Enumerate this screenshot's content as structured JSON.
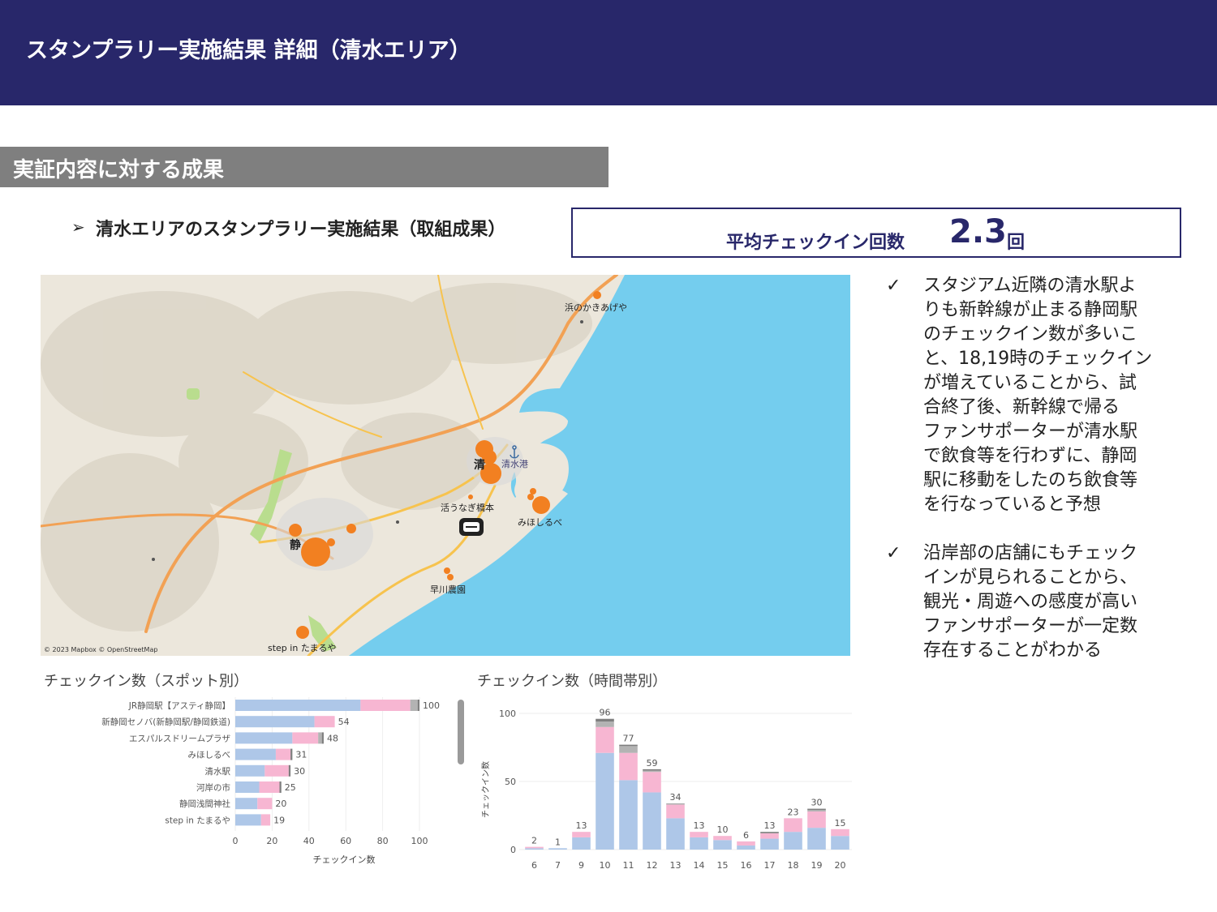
{
  "header": {
    "title": "スタンプラリー実施結果 詳細（清水エリア）"
  },
  "section": {
    "title": "実証内容に対する成果"
  },
  "subheading": {
    "marker": "➢",
    "text": "清水エリアのスタンプラリー実施結果（取組成果）"
  },
  "summary": {
    "label": "平均チェックイン回数",
    "value": "2.3",
    "unit": "回"
  },
  "map": {
    "attribution": "© 2023 Mapbox © OpenStreetMap",
    "labels": {
      "hama": "浜のかきあげや",
      "shimizu_port": "清水港",
      "katsu": "活うなぎ橋本",
      "mihoshirube": "みほしるべ",
      "hayakawa": "早川農園",
      "stepin": "step in たまるや",
      "shimizu_char": "清",
      "shizuoka_char": "静"
    },
    "colors": {
      "land": "#ece7dc",
      "sea": "#74cdee",
      "marker": "#f28021",
      "road": "#f7c34e",
      "highway": "#f2a154",
      "green": "#b9dd8e"
    }
  },
  "notes": [
    {
      "check": "✓",
      "lines": [
        "スタジアム近隣の清水駅よ",
        "りも新幹線が止まる静岡駅",
        "のチェックイン数が多いこ",
        "と、18,19時のチェックイン",
        "が増えていることから、試",
        "合終了後、新幹線で帰る",
        "ファンサポーターが清水駅",
        "で飲食等を行わずに、静岡",
        "駅に移動をしたのち飲食等",
        "を行なっていると予想"
      ]
    },
    {
      "check": "✓",
      "lines": [
        "沿岸部の店舗にもチェック",
        "インが見られることから、",
        "観光・周遊への感度が高い",
        "ファンサポーターが一定数",
        "存在することがわかる"
      ]
    }
  ],
  "chart_data": [
    {
      "type": "bar",
      "orientation": "horizontal",
      "stacked": true,
      "title": "チェックイン数（スポット別）",
      "xlabel": "チェックイン数",
      "ylabel": "",
      "xlim": [
        0,
        110
      ],
      "xticks": [
        0,
        20,
        40,
        60,
        80,
        100
      ],
      "categories": [
        "JR静岡駅【アスティ静岡】",
        "新静岡セノバ(新静岡駅/静岡鉄道)",
        "エスパルスドリームプラザ",
        "みほしるべ",
        "清水駅",
        "河岸の市",
        "静岡浅間神社",
        "step in たまるや"
      ],
      "series": [
        {
          "color": "#aec7e8",
          "values": [
            68,
            43,
            31,
            22,
            16,
            13,
            12,
            14
          ]
        },
        {
          "color": "#f7b6d2",
          "values": [
            27,
            11,
            14,
            8,
            13,
            11,
            8,
            5
          ]
        },
        {
          "color": "#b3b3b3",
          "values": [
            4,
            0,
            2,
            0,
            0,
            0,
            0,
            0
          ]
        },
        {
          "color": "#7f7f7f",
          "values": [
            1,
            0,
            1,
            1,
            1,
            1,
            0,
            0
          ]
        }
      ],
      "totals": [
        100,
        54,
        48,
        31,
        30,
        25,
        20,
        19
      ],
      "colors": {
        "blue": "#aec7e8",
        "pink": "#f7b6d2",
        "grey": "#b3b3b3",
        "dark": "#7f7f7f"
      }
    },
    {
      "type": "bar",
      "stacked": true,
      "title": "チェックイン数（時間帯別）",
      "xlabel": "",
      "ylabel": "チェックイン数",
      "ylim": [
        0,
        100
      ],
      "yticks": [
        0,
        50,
        100
      ],
      "categories": [
        "6",
        "7",
        "9",
        "10",
        "11",
        "12",
        "13",
        "14",
        "15",
        "16",
        "17",
        "18",
        "19",
        "20"
      ],
      "series": [
        {
          "color": "#aec7e8",
          "values": [
            1,
            1,
            9,
            71,
            51,
            42,
            23,
            9,
            7,
            3,
            8,
            13,
            16,
            10
          ]
        },
        {
          "color": "#f7b6d2",
          "values": [
            1,
            0,
            4,
            19,
            20,
            15,
            10,
            4,
            3,
            3,
            4,
            10,
            12,
            5
          ]
        },
        {
          "color": "#b3b3b3",
          "values": [
            0,
            0,
            0,
            4,
            5,
            1,
            1,
            0,
            0,
            0,
            0,
            0,
            1,
            0
          ]
        },
        {
          "color": "#7f7f7f",
          "values": [
            0,
            0,
            0,
            2,
            1,
            1,
            0,
            0,
            0,
            0,
            1,
            0,
            1,
            0
          ]
        }
      ],
      "totals": [
        2,
        1,
        13,
        96,
        77,
        59,
        34,
        13,
        10,
        6,
        13,
        23,
        30,
        15
      ]
    }
  ]
}
